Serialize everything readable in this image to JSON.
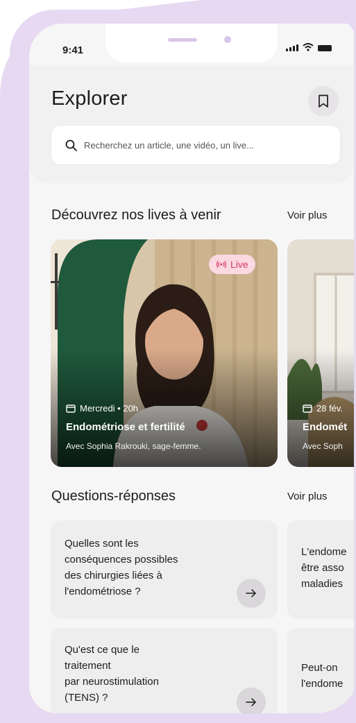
{
  "status_bar": {
    "time": "9:41"
  },
  "header": {
    "title": "Explorer",
    "search_placeholder": "Recherchez un article, une vidéo, un live..."
  },
  "lives_section": {
    "title": "Découvrez nos lives à venir",
    "see_more": "Voir plus",
    "cards": [
      {
        "badge": "Live",
        "date": "Mercredi • 20h",
        "title": "Endométriose et fertilité",
        "subtitle": "Avec Sophia Rakrouki, sage-femme."
      },
      {
        "date": "28 fév.",
        "title": "Endomét",
        "subtitle": "Avec Soph"
      }
    ]
  },
  "qa_section": {
    "title": "Questions-réponses",
    "see_more": "Voir plus",
    "cards": [
      {
        "lines": [
          "Quelles sont les",
          "conséquences possibles",
          "des chirurgies liées à",
          "l'endométriose ?"
        ]
      },
      {
        "lines": [
          "L'endome",
          "être asso",
          "maladies"
        ]
      },
      {
        "lines": [
          "Qu'est ce que le",
          "traitement",
          "par neurostimulation",
          "(TENS) ?"
        ]
      },
      {
        "lines": [
          "Peut-on",
          "l'endome"
        ]
      }
    ]
  },
  "colors": {
    "frame": "#e7d9f1",
    "live_badge_bg": "#fbd8e2",
    "live_badge_text": "#d63a66"
  }
}
